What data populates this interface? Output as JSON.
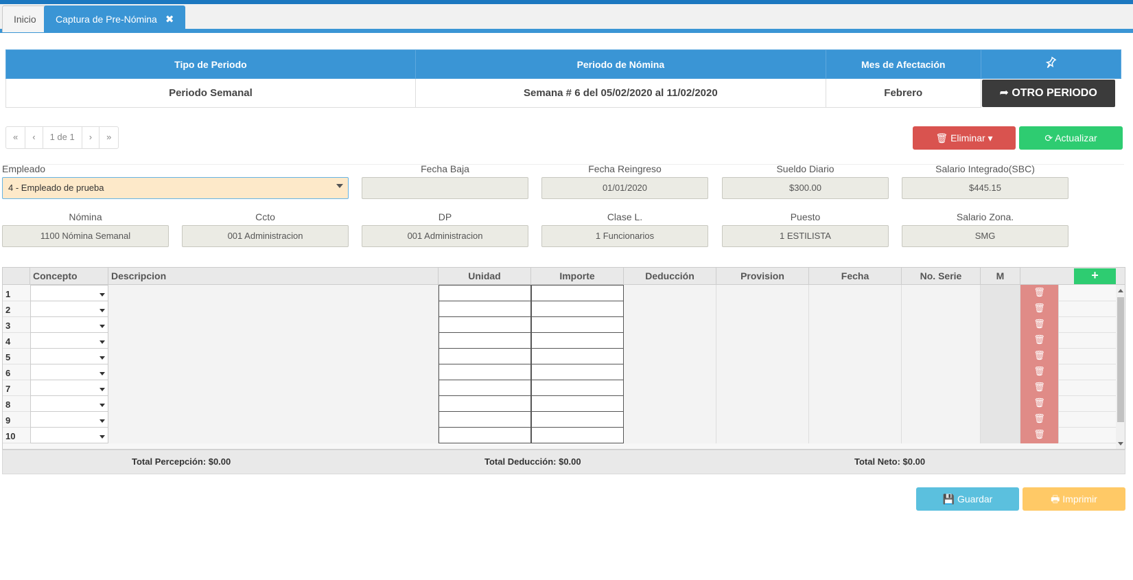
{
  "tabs": {
    "home": "Inicio",
    "active": "Captura de Pre-Nómina",
    "close_icon": "✖"
  },
  "period": {
    "headers": [
      "Tipo de Periodo",
      "Periodo de Nómina",
      "Mes de Afectación"
    ],
    "values": [
      "Periodo Semanal",
      "Semana # 6 del 05/02/2020 al 11/02/2020",
      "Febrero"
    ],
    "pin_icon": "pin-icon",
    "other_button": "OTRO PERIODO"
  },
  "pager": {
    "first": "«",
    "prev": "‹",
    "page": "1 de 1",
    "next": "›",
    "last": "»"
  },
  "actions": {
    "delete": "Eliminar",
    "update": "Actualizar",
    "save": "Guardar",
    "print": "Imprimir"
  },
  "fields": {
    "empleado": {
      "label": "Empleado",
      "value": "4 - Empleado de prueba"
    },
    "fecha_baja": {
      "label": "Fecha Baja",
      "value": ""
    },
    "fecha_reingreso": {
      "label": "Fecha Reingreso",
      "value": "01/01/2020"
    },
    "sueldo_diario": {
      "label": "Sueldo Diario",
      "value": "$300.00"
    },
    "salario_integrado": {
      "label": "Salario Integrado(SBC)",
      "value": "$445.15"
    },
    "nomina": {
      "label": "Nómina",
      "value": "1100 Nómina Semanal"
    },
    "ccto": {
      "label": "Ccto",
      "value": "001 Administracion"
    },
    "dp": {
      "label": "DP",
      "value": "001 Administracion"
    },
    "clase": {
      "label": "Clase L.",
      "value": "1 Funcionarios"
    },
    "puesto": {
      "label": "Puesto",
      "value": "1 ESTILISTA"
    },
    "salario_zona": {
      "label": "Salario Zona.",
      "value": "SMG"
    }
  },
  "grid": {
    "columns": [
      "Concepto",
      "Descripcion",
      "Unidad",
      "Importe",
      "Deducción",
      "Provision",
      "Fecha",
      "No. Serie",
      "M"
    ],
    "add_label": "+",
    "rows": [
      "1",
      "2",
      "3",
      "4",
      "5",
      "6",
      "7",
      "8",
      "9",
      "10"
    ]
  },
  "totals": {
    "percepcion": "Total Percepción: $0.00",
    "deduccion": "Total Deducción: $0.00",
    "neto": "Total Neto: $0.00"
  },
  "colors": {
    "primary": "#3a95d5",
    "danger": "#d9534f",
    "success": "#2ecc71",
    "info": "#5bc0de",
    "warning": "#ffc966",
    "dark": "#3b3b3b"
  }
}
